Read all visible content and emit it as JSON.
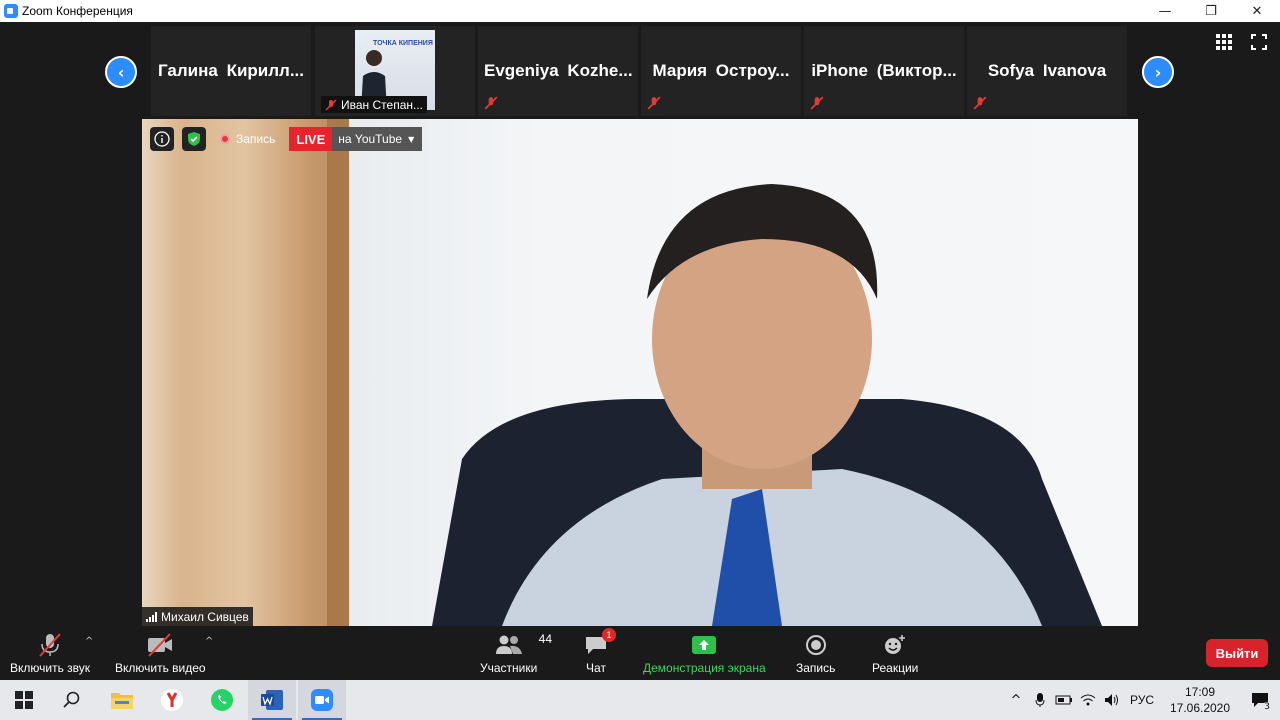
{
  "window": {
    "title": "Zoom Конференция",
    "minimize": "—",
    "restore": "❐",
    "close": "✕"
  },
  "strip": {
    "prev": "‹",
    "next": "›",
    "tiles": [
      {
        "name": "Галина Кирилл..."
      },
      {
        "name": "Иван Степан...",
        "thumb_logo": "ТОЧКА КИПЕНИЯ"
      },
      {
        "name": "Evgeniya Kozhe..."
      },
      {
        "name": "Мария Остроу..."
      },
      {
        "name": "iPhone (Виктор..."
      },
      {
        "name": "Sofya Ivanova"
      }
    ]
  },
  "video": {
    "recording_label": "Запись",
    "live_label": "LIVE",
    "stream_target": "на YouTube",
    "speaker_name": "Михаил Сивцев"
  },
  "toolbar": {
    "audio": "Включить звук",
    "video": "Включить видео",
    "participants": "Участники",
    "participants_count": "44",
    "chat": "Чат",
    "chat_badge": "1",
    "share": "Демонстрация экрана",
    "record": "Запись",
    "reactions": "Реакции",
    "exit": "Выйти"
  },
  "taskbar": {
    "lang": "РУС",
    "time": "17:09",
    "date": "17.06.2020",
    "notif_count": "3"
  },
  "colors": {
    "zoom_blue": "#2d8cff",
    "live_red": "#e8232e",
    "share_green": "#3fd35c",
    "exit_red": "#d9232b"
  }
}
